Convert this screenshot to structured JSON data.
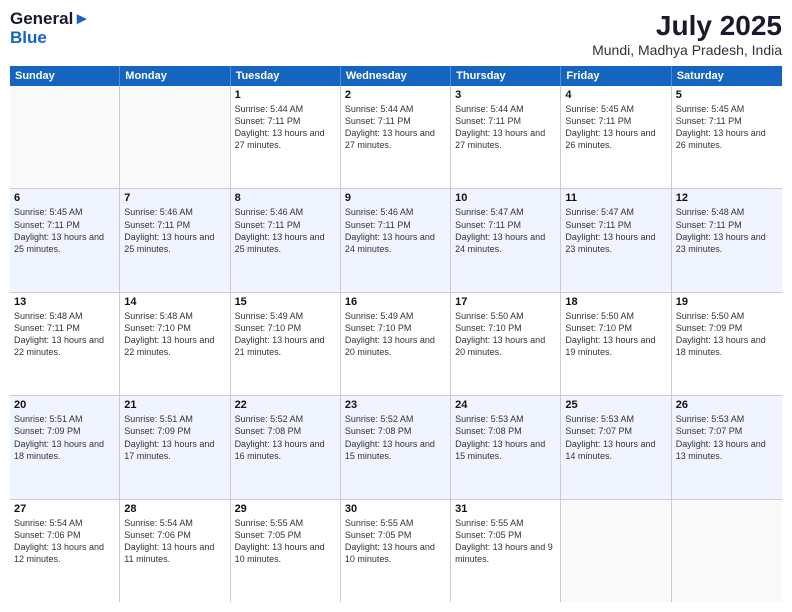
{
  "header": {
    "logo_line1": "General",
    "logo_line2": "Blue",
    "month_year": "July 2025",
    "location": "Mundi, Madhya Pradesh, India"
  },
  "weekdays": [
    "Sunday",
    "Monday",
    "Tuesday",
    "Wednesday",
    "Thursday",
    "Friday",
    "Saturday"
  ],
  "weeks": [
    [
      {
        "day": "",
        "sunrise": "",
        "sunset": "",
        "daylight": ""
      },
      {
        "day": "",
        "sunrise": "",
        "sunset": "",
        "daylight": ""
      },
      {
        "day": "1",
        "sunrise": "Sunrise: 5:44 AM",
        "sunset": "Sunset: 7:11 PM",
        "daylight": "Daylight: 13 hours and 27 minutes."
      },
      {
        "day": "2",
        "sunrise": "Sunrise: 5:44 AM",
        "sunset": "Sunset: 7:11 PM",
        "daylight": "Daylight: 13 hours and 27 minutes."
      },
      {
        "day": "3",
        "sunrise": "Sunrise: 5:44 AM",
        "sunset": "Sunset: 7:11 PM",
        "daylight": "Daylight: 13 hours and 27 minutes."
      },
      {
        "day": "4",
        "sunrise": "Sunrise: 5:45 AM",
        "sunset": "Sunset: 7:11 PM",
        "daylight": "Daylight: 13 hours and 26 minutes."
      },
      {
        "day": "5",
        "sunrise": "Sunrise: 5:45 AM",
        "sunset": "Sunset: 7:11 PM",
        "daylight": "Daylight: 13 hours and 26 minutes."
      }
    ],
    [
      {
        "day": "6",
        "sunrise": "Sunrise: 5:45 AM",
        "sunset": "Sunset: 7:11 PM",
        "daylight": "Daylight: 13 hours and 25 minutes."
      },
      {
        "day": "7",
        "sunrise": "Sunrise: 5:46 AM",
        "sunset": "Sunset: 7:11 PM",
        "daylight": "Daylight: 13 hours and 25 minutes."
      },
      {
        "day": "8",
        "sunrise": "Sunrise: 5:46 AM",
        "sunset": "Sunset: 7:11 PM",
        "daylight": "Daylight: 13 hours and 25 minutes."
      },
      {
        "day": "9",
        "sunrise": "Sunrise: 5:46 AM",
        "sunset": "Sunset: 7:11 PM",
        "daylight": "Daylight: 13 hours and 24 minutes."
      },
      {
        "day": "10",
        "sunrise": "Sunrise: 5:47 AM",
        "sunset": "Sunset: 7:11 PM",
        "daylight": "Daylight: 13 hours and 24 minutes."
      },
      {
        "day": "11",
        "sunrise": "Sunrise: 5:47 AM",
        "sunset": "Sunset: 7:11 PM",
        "daylight": "Daylight: 13 hours and 23 minutes."
      },
      {
        "day": "12",
        "sunrise": "Sunrise: 5:48 AM",
        "sunset": "Sunset: 7:11 PM",
        "daylight": "Daylight: 13 hours and 23 minutes."
      }
    ],
    [
      {
        "day": "13",
        "sunrise": "Sunrise: 5:48 AM",
        "sunset": "Sunset: 7:11 PM",
        "daylight": "Daylight: 13 hours and 22 minutes."
      },
      {
        "day": "14",
        "sunrise": "Sunrise: 5:48 AM",
        "sunset": "Sunset: 7:10 PM",
        "daylight": "Daylight: 13 hours and 22 minutes."
      },
      {
        "day": "15",
        "sunrise": "Sunrise: 5:49 AM",
        "sunset": "Sunset: 7:10 PM",
        "daylight": "Daylight: 13 hours and 21 minutes."
      },
      {
        "day": "16",
        "sunrise": "Sunrise: 5:49 AM",
        "sunset": "Sunset: 7:10 PM",
        "daylight": "Daylight: 13 hours and 20 minutes."
      },
      {
        "day": "17",
        "sunrise": "Sunrise: 5:50 AM",
        "sunset": "Sunset: 7:10 PM",
        "daylight": "Daylight: 13 hours and 20 minutes."
      },
      {
        "day": "18",
        "sunrise": "Sunrise: 5:50 AM",
        "sunset": "Sunset: 7:10 PM",
        "daylight": "Daylight: 13 hours and 19 minutes."
      },
      {
        "day": "19",
        "sunrise": "Sunrise: 5:50 AM",
        "sunset": "Sunset: 7:09 PM",
        "daylight": "Daylight: 13 hours and 18 minutes."
      }
    ],
    [
      {
        "day": "20",
        "sunrise": "Sunrise: 5:51 AM",
        "sunset": "Sunset: 7:09 PM",
        "daylight": "Daylight: 13 hours and 18 minutes."
      },
      {
        "day": "21",
        "sunrise": "Sunrise: 5:51 AM",
        "sunset": "Sunset: 7:09 PM",
        "daylight": "Daylight: 13 hours and 17 minutes."
      },
      {
        "day": "22",
        "sunrise": "Sunrise: 5:52 AM",
        "sunset": "Sunset: 7:08 PM",
        "daylight": "Daylight: 13 hours and 16 minutes."
      },
      {
        "day": "23",
        "sunrise": "Sunrise: 5:52 AM",
        "sunset": "Sunset: 7:08 PM",
        "daylight": "Daylight: 13 hours and 15 minutes."
      },
      {
        "day": "24",
        "sunrise": "Sunrise: 5:53 AM",
        "sunset": "Sunset: 7:08 PM",
        "daylight": "Daylight: 13 hours and 15 minutes."
      },
      {
        "day": "25",
        "sunrise": "Sunrise: 5:53 AM",
        "sunset": "Sunset: 7:07 PM",
        "daylight": "Daylight: 13 hours and 14 minutes."
      },
      {
        "day": "26",
        "sunrise": "Sunrise: 5:53 AM",
        "sunset": "Sunset: 7:07 PM",
        "daylight": "Daylight: 13 hours and 13 minutes."
      }
    ],
    [
      {
        "day": "27",
        "sunrise": "Sunrise: 5:54 AM",
        "sunset": "Sunset: 7:06 PM",
        "daylight": "Daylight: 13 hours and 12 minutes."
      },
      {
        "day": "28",
        "sunrise": "Sunrise: 5:54 AM",
        "sunset": "Sunset: 7:06 PM",
        "daylight": "Daylight: 13 hours and 11 minutes."
      },
      {
        "day": "29",
        "sunrise": "Sunrise: 5:55 AM",
        "sunset": "Sunset: 7:05 PM",
        "daylight": "Daylight: 13 hours and 10 minutes."
      },
      {
        "day": "30",
        "sunrise": "Sunrise: 5:55 AM",
        "sunset": "Sunset: 7:05 PM",
        "daylight": "Daylight: 13 hours and 10 minutes."
      },
      {
        "day": "31",
        "sunrise": "Sunrise: 5:55 AM",
        "sunset": "Sunset: 7:05 PM",
        "daylight": "Daylight: 13 hours and 9 minutes."
      },
      {
        "day": "",
        "sunrise": "",
        "sunset": "",
        "daylight": ""
      },
      {
        "day": "",
        "sunrise": "",
        "sunset": "",
        "daylight": ""
      }
    ]
  ]
}
